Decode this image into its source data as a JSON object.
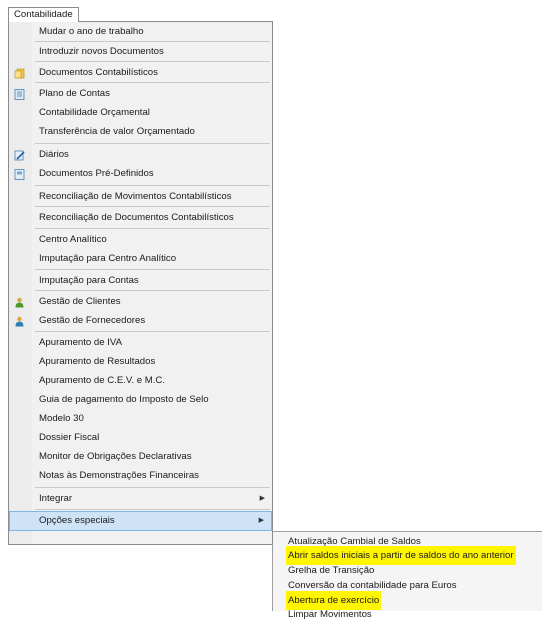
{
  "menubar": {
    "title": "Contabilidade"
  },
  "menu": {
    "items": [
      {
        "label": "Mudar o ano de trabalho",
        "icon": ""
      },
      {
        "label": "Introduzir novos Documentos",
        "icon": ""
      },
      {
        "label": "Documentos Contabilísticos",
        "icon": "documents-icon"
      },
      {
        "label": "Plano de Contas",
        "icon": "ledger-icon"
      },
      {
        "label": "Contabilidade Orçamental",
        "icon": ""
      },
      {
        "label": "Transferência de valor Orçamentado",
        "icon": ""
      },
      {
        "label": "Diários",
        "icon": "edit-journal-icon"
      },
      {
        "label": "Documentos Pré-Definidos",
        "icon": "predefined-docs-icon"
      },
      {
        "label": "Reconciliação de Movimentos Contabilísticos",
        "icon": ""
      },
      {
        "label": "Reconciliação de Documentos Contabilísticos",
        "icon": ""
      },
      {
        "label": "Centro Analítico",
        "icon": ""
      },
      {
        "label": "Imputação para Centro Analítico",
        "icon": ""
      },
      {
        "label": "Imputação para Contas",
        "icon": ""
      },
      {
        "label": "Gestão de Clientes",
        "icon": "customers-icon"
      },
      {
        "label": "Gestão de Fornecedores",
        "icon": "suppliers-icon"
      },
      {
        "label": "Apuramento de IVA",
        "icon": ""
      },
      {
        "label": "Apuramento de Resultados",
        "icon": ""
      },
      {
        "label": "Apuramento de C.E.V. e M.C.",
        "icon": ""
      },
      {
        "label": "Guia de pagamento do Imposto de Selo",
        "icon": ""
      },
      {
        "label": "Modelo 30",
        "icon": ""
      },
      {
        "label": "Dossier Fiscal",
        "icon": ""
      },
      {
        "label": "Monitor de Obrigações Declarativas",
        "icon": ""
      },
      {
        "label": "Notas às Demonstrações Financeiras",
        "icon": ""
      },
      {
        "label": "Integrar",
        "icon": "",
        "has_submenu": true
      },
      {
        "label": "Opções especiais",
        "icon": "",
        "has_submenu": true,
        "active": true
      }
    ]
  },
  "submenu": {
    "items": [
      {
        "label": "Atualização Cambial de Saldos",
        "highlighted": false
      },
      {
        "label": "Abrir saldos iniciais a partir de saldos do ano anterior",
        "highlighted": true
      },
      {
        "label": "Grelha de Transição",
        "highlighted": false
      },
      {
        "label": "Conversão da contabilidade para Euros",
        "highlighted": false
      },
      {
        "label": "Abertura de exercício",
        "highlighted": true
      },
      {
        "label": "Limpar Movimentos",
        "highlighted": false
      }
    ]
  },
  "colors": {
    "highlight": "#fff500",
    "active_bg": "#cfe3f7",
    "active_border": "#7eb4ea"
  }
}
